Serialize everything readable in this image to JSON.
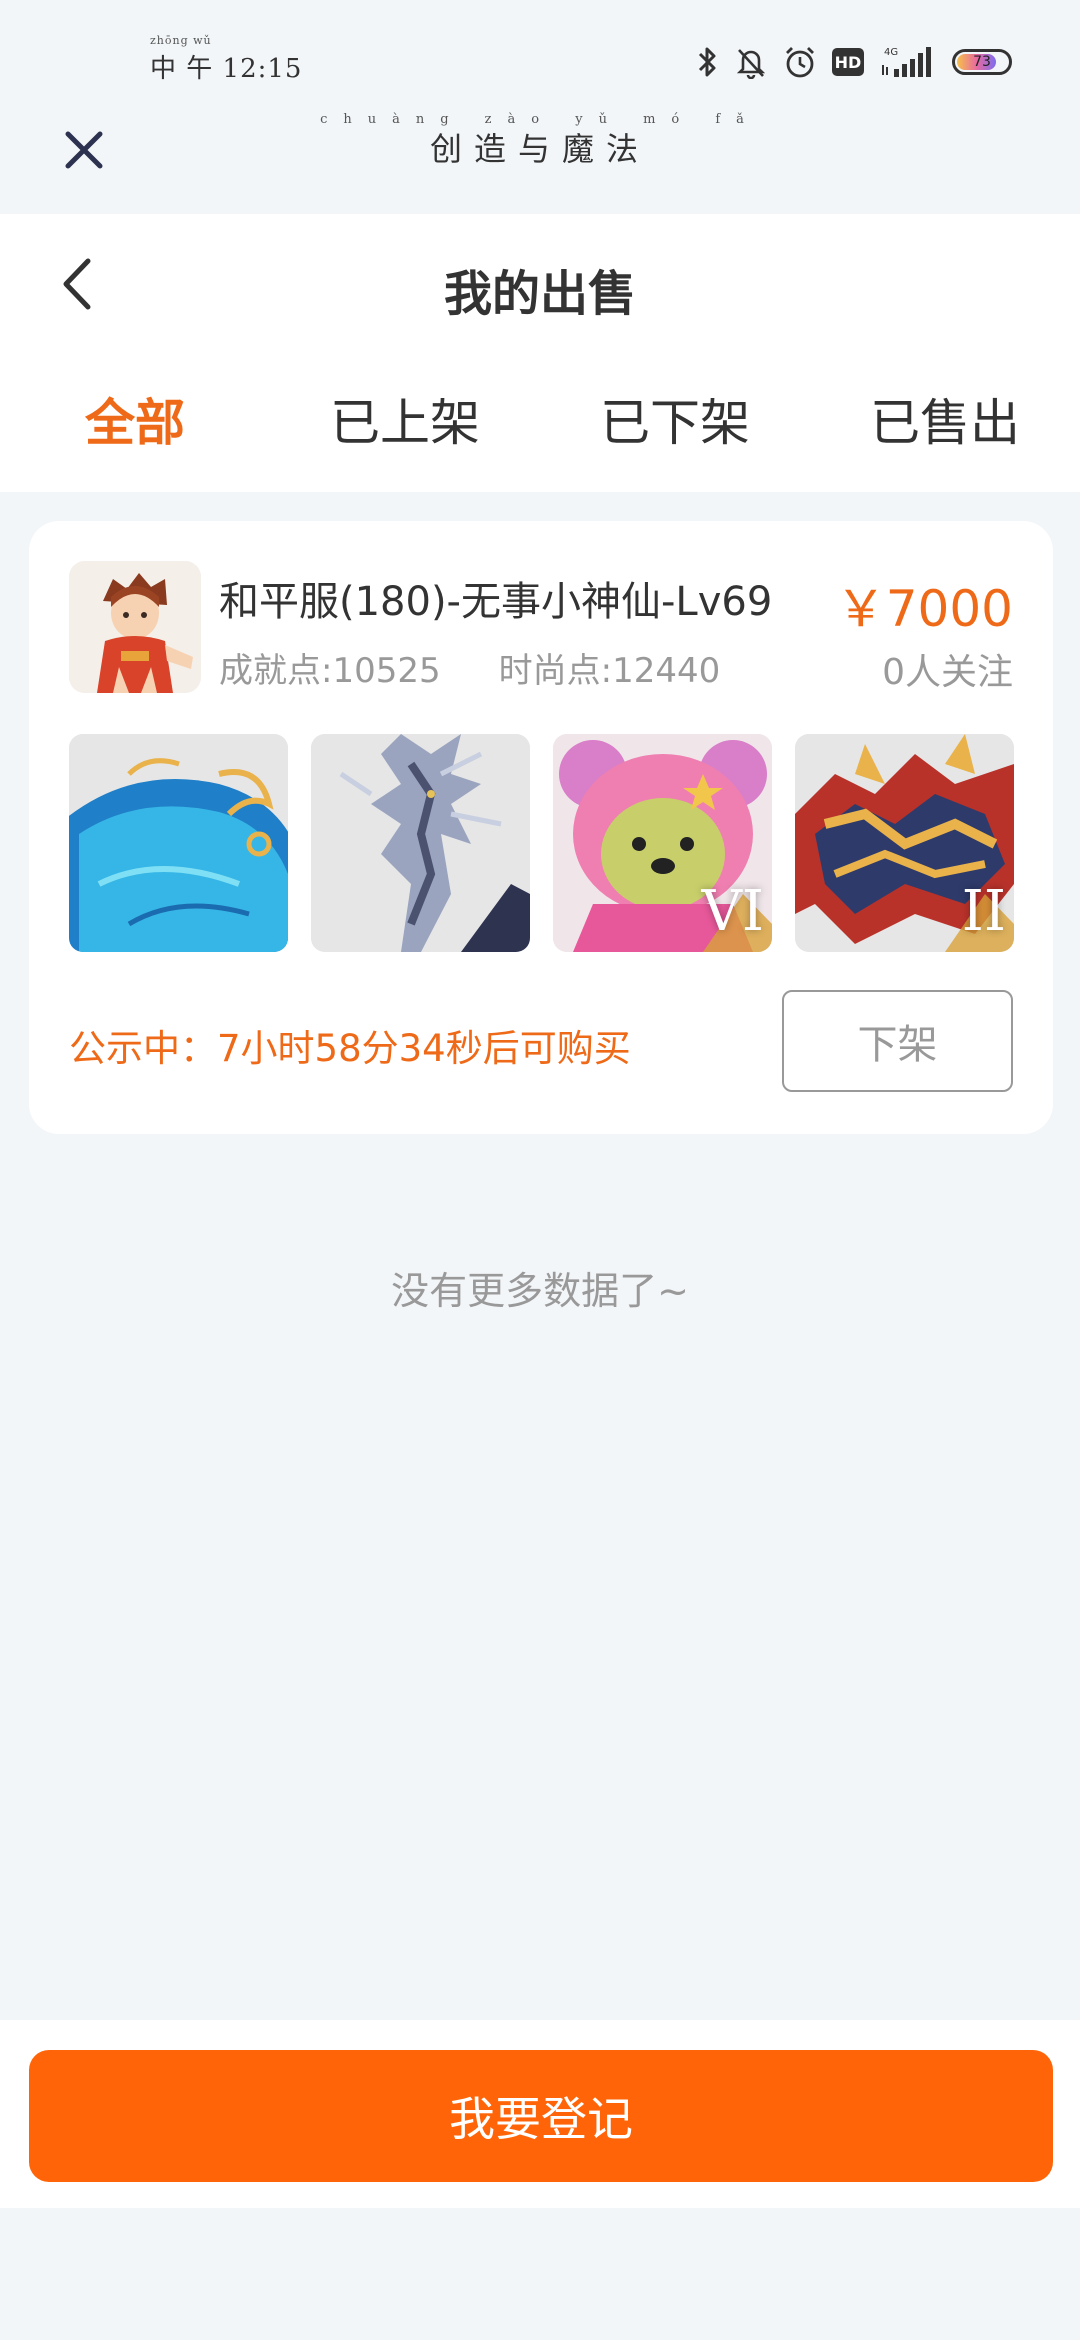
{
  "status_bar": {
    "time_ruby": "zhōng wǔ",
    "time": "中 午 12:15",
    "network": "4G",
    "battery": "73"
  },
  "mini_program": {
    "title_ruby": "chuàng zào yǔ mó fǎ",
    "title": "创造与魔法"
  },
  "nav": {
    "title": "我的出售"
  },
  "tabs": [
    {
      "label": "全部",
      "active": true
    },
    {
      "label": "已上架",
      "active": false
    },
    {
      "label": "已下架",
      "active": false
    },
    {
      "label": "已售出",
      "active": false
    }
  ],
  "listing": {
    "name": "和平服(180)-无事小神仙-Lv69",
    "achievement": "成就点:10525",
    "fashion": "时尚点:12440",
    "price": "￥7000",
    "followers": "0人关注",
    "thumbnails": [
      {
        "icon": "blue-whale-mount",
        "rank": ""
      },
      {
        "icon": "silver-dragon-mount",
        "rank": ""
      },
      {
        "icon": "pink-bear-pet",
        "rank": "VI"
      },
      {
        "icon": "golden-dragon-mount",
        "rank": "II"
      }
    ],
    "notice": "公示中：7小时58分34秒后可购买",
    "delist_label": "下架"
  },
  "footer_text": "没有更多数据了~",
  "register_label": "我要登记",
  "colors": {
    "accent": "#ee6a18",
    "button": "#ff6508",
    "background": "#f3f6f9"
  }
}
